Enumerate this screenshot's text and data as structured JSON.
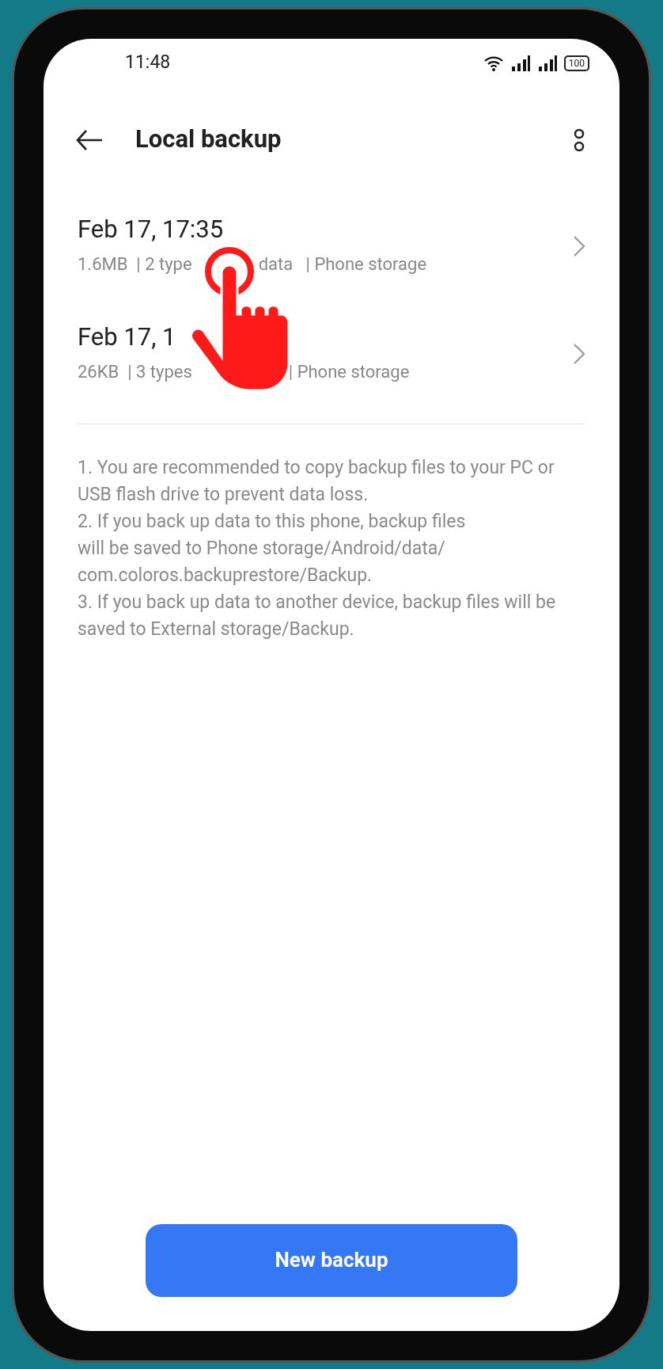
{
  "status_bar": {
    "time": "11:48",
    "battery": "100"
  },
  "header": {
    "title": "Local backup"
  },
  "backups": [
    {
      "title": "Feb 17, 17:35",
      "subtitle_parts": [
        "1.6MB  | 2 type",
        "data   | Phone storage"
      ]
    },
    {
      "title": "Feb 17, 1",
      "subtitle_parts": [
        "26KB  | 3 types",
        "| Phone storage"
      ]
    }
  ],
  "notes": [
    "1. You are recommended to copy backup files to your PC or USB flash drive to prevent data loss.",
    "2. If you back up data to this phone, backup files\nwill be saved to Phone storage/Android/data/\ncom.coloros.backuprestore/Backup.",
    "3. If you back up data to another device, backup files will be saved to External storage/Backup."
  ],
  "primary_button": {
    "label": "New backup"
  }
}
